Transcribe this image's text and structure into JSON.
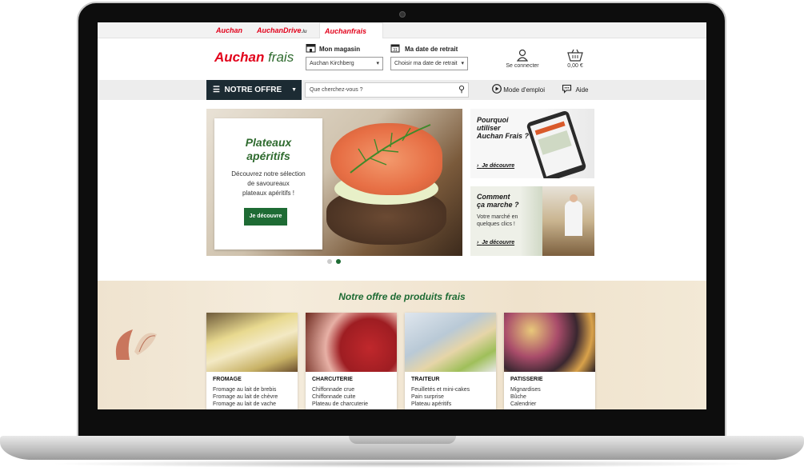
{
  "brand_tabs": [
    {
      "label": "Auchan",
      "suffix": ""
    },
    {
      "label": "AuchanDrive",
      "suffix": ".lu"
    },
    {
      "label": "Auchanfrais",
      "suffix": ""
    }
  ],
  "logo": {
    "part1": "Auchan",
    "part2": "frais"
  },
  "store": {
    "label": "Mon magasin",
    "value": "Auchan Kirchberg"
  },
  "pickup": {
    "label": "Ma date de retrait",
    "value": "Choisir ma date de retrait"
  },
  "account": {
    "login_label": "Se connecter",
    "cart_total": "0,00 €"
  },
  "nav": {
    "offer_label": "NOTRE OFFRE",
    "search_placeholder": "Que cherchez-vous ?",
    "howto_label": "Mode d'emploi",
    "help_label": "Aide"
  },
  "hero": {
    "title_line1": "Plateaux",
    "title_line2": "apéritifs",
    "text_line1": "Découvrez notre sélection",
    "text_line2": "de savoureaux",
    "text_line3": "plateaux apéritifs !",
    "button": "Je découvre",
    "active_slide": 2,
    "slide_count": 2
  },
  "promos": [
    {
      "title_lines": [
        "Pourquoi",
        "utiliser",
        "Auchan Frais ?"
      ],
      "text_lines": [],
      "link": "Je découvre"
    },
    {
      "title_lines": [
        "Comment",
        "ça marche ?"
      ],
      "text_lines": [
        "Votre marché en",
        "quelques clics !"
      ],
      "link": "Je découvre"
    }
  ],
  "section_title": "Notre offre de produits frais",
  "categories": [
    {
      "name": "FROMAGE",
      "items": [
        "Fromage au lait de brebis",
        "Fromage au lait de chèvre",
        "Fromage au lait de vache"
      ]
    },
    {
      "name": "CHARCUTERIE",
      "items": [
        "Chiffonnade crue",
        "Chiffonnade cuite",
        "Plateau de charcuterie"
      ]
    },
    {
      "name": "TRAITEUR",
      "items": [
        "Feuilletés et mini-cakes",
        "Pain surprise",
        "Plateau apéritifs"
      ]
    },
    {
      "name": "PATISSERIE",
      "items": [
        "Mignardises",
        "Bûche",
        "Calendrier"
      ]
    }
  ],
  "colors": {
    "brand_red": "#e2001a",
    "brand_green": "#1e6b34",
    "nav_dark": "#1c2b33"
  }
}
